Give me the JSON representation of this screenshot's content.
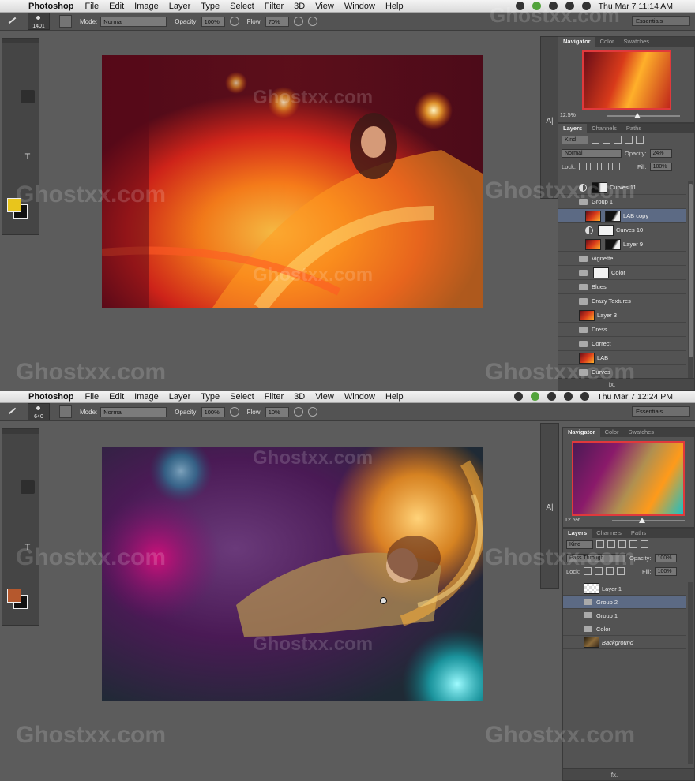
{
  "watermark": "Ghostxx.com",
  "screens": [
    {
      "menubar": {
        "app": "Photoshop",
        "items": [
          "File",
          "Edit",
          "Image",
          "Layer",
          "Type",
          "Select",
          "Filter",
          "3D",
          "View",
          "Window",
          "Help"
        ],
        "clock": "Thu Mar 7  11:14 AM"
      },
      "options": {
        "brush_size": "1401",
        "mode_label": "Mode:",
        "mode_value": "Normal",
        "opacity_label": "Opacity:",
        "opacity_value": "100%",
        "flow_label": "Flow:",
        "flow_value": "70%",
        "workspace": "Essentials"
      },
      "foreground_color": "#e8c51c",
      "navigator": {
        "tabs": [
          "Navigator",
          "Color",
          "Swatches"
        ],
        "zoom": "12.5%"
      },
      "layers_panel": {
        "tabs": [
          "Layers",
          "Channels",
          "Paths"
        ],
        "filter": "Kind",
        "blend_mode": "Normal",
        "opacity_label": "Opacity:",
        "opacity_value": "24%",
        "lock_label": "Lock:",
        "fill_label": "Fill:",
        "fill_value": "100%",
        "layers": [
          {
            "name": "Curves 11",
            "kind": "adjustment"
          },
          {
            "name": "Group 1",
            "kind": "group-open"
          },
          {
            "name": "LAB copy",
            "kind": "image-mask",
            "selected": true
          },
          {
            "name": "Curves 10",
            "kind": "adjustment"
          },
          {
            "name": "Layer 9",
            "kind": "image-mask"
          },
          {
            "name": "Vignette",
            "kind": "group"
          },
          {
            "name": "Color",
            "kind": "group-mask"
          },
          {
            "name": "Blues",
            "kind": "group"
          },
          {
            "name": "Crazy Textures",
            "kind": "group"
          },
          {
            "name": "Layer 3",
            "kind": "image"
          },
          {
            "name": "Dress",
            "kind": "group"
          },
          {
            "name": "Correct",
            "kind": "group"
          },
          {
            "name": "LAB",
            "kind": "image"
          },
          {
            "name": "Curves",
            "kind": "group"
          }
        ]
      }
    },
    {
      "menubar": {
        "app": "Photoshop",
        "items": [
          "File",
          "Edit",
          "Image",
          "Layer",
          "Type",
          "Select",
          "Filter",
          "3D",
          "View",
          "Window",
          "Help"
        ],
        "clock": "Thu Mar 7  12:24 PM"
      },
      "options": {
        "brush_size": "640",
        "mode_label": "Mode:",
        "mode_value": "Normal",
        "opacity_label": "Opacity:",
        "opacity_value": "100%",
        "flow_label": "Flow:",
        "flow_value": "10%",
        "workspace": "Essentials"
      },
      "foreground_color": "#b5582d",
      "navigator": {
        "tabs": [
          "Navigator",
          "Color",
          "Swatches"
        ],
        "zoom": "12.5%"
      },
      "layers_panel": {
        "tabs": [
          "Layers",
          "Channels",
          "Paths"
        ],
        "filter": "Kind",
        "blend_mode": "Pass Through",
        "opacity_label": "Opacity:",
        "opacity_value": "100%",
        "lock_label": "Lock:",
        "fill_label": "Fill:",
        "fill_value": "100%",
        "layers": [
          {
            "name": "Layer 1",
            "kind": "transparent",
            "hidden": true
          },
          {
            "name": "Group 2",
            "kind": "group",
            "selected": true
          },
          {
            "name": "Group 1",
            "kind": "group"
          },
          {
            "name": "Color",
            "kind": "group"
          },
          {
            "name": "Background",
            "kind": "background",
            "italic": true,
            "locked": true
          }
        ]
      }
    }
  ]
}
